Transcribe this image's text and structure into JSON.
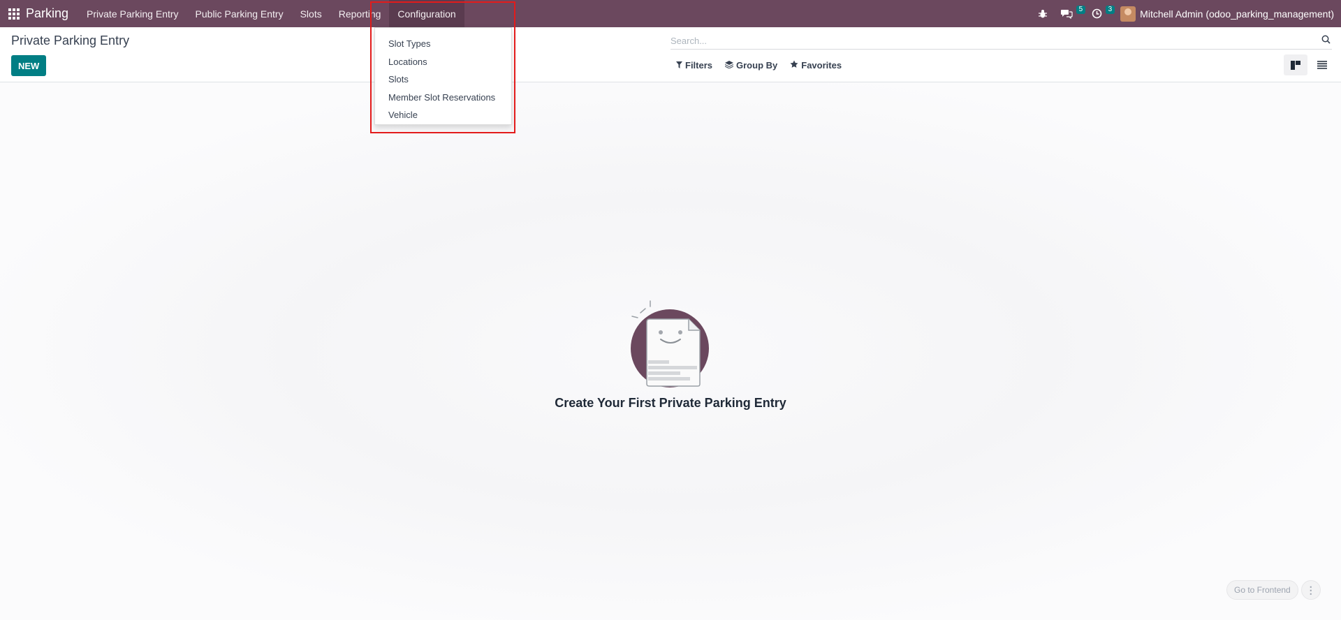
{
  "navbar": {
    "app_name": "Parking",
    "menu": [
      {
        "label": "Private Parking Entry"
      },
      {
        "label": "Public Parking Entry"
      },
      {
        "label": "Slots"
      },
      {
        "label": "Reporting"
      },
      {
        "label": "Configuration"
      }
    ],
    "messages_count": "5",
    "activities_count": "3",
    "user_name": "Mitchell Admin (odoo_parking_management)"
  },
  "control_panel": {
    "title": "Private Parking Entry",
    "new_label": "NEW",
    "search_placeholder": "Search...",
    "filters_label": "Filters",
    "groupby_label": "Group By",
    "favorites_label": "Favorites"
  },
  "dropdown": {
    "items": [
      {
        "label": "Slot Types"
      },
      {
        "label": "Locations"
      },
      {
        "label": "Slots"
      },
      {
        "label": "Member Slot Reservations"
      },
      {
        "label": "Vehicle"
      }
    ]
  },
  "empty_state": {
    "title": "Create Your First Private Parking Entry"
  },
  "footer": {
    "frontend_label": "Go to Frontend",
    "more_label": "⋮"
  },
  "colors": {
    "navbar": "#6b485e",
    "primary": "#017e84",
    "highlight": "#e31b1b"
  }
}
